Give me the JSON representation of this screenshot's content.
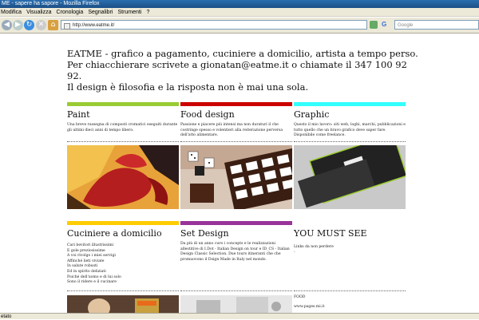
{
  "window": {
    "title": "ME - sapere ha sapore - Mozilla Firefox"
  },
  "menu": [
    "Modifica",
    "Visualizza",
    "Cronologia",
    "Segnalibri",
    "Strumenti",
    "?"
  ],
  "nav": {
    "url": "http://www.eatme.it/",
    "search_placeholder": "Google"
  },
  "intro": {
    "line1": "EATME - grafico a pagamento, cuciniere a domicilio, artista a tempo perso.",
    "line2": "Per chiacchierare scrivete a gionatan@eatme.it o chiamate il 347 100 92 92.",
    "line3": "Il design è filosofia e la risposta non è mai una sola."
  },
  "sections": {
    "paint": {
      "title": "Paint",
      "text": "Una breve rassegna di composti cromatici eseguiti durante gli ultimi dieci anni di tempo libero.",
      "color": "#99cc33"
    },
    "food": {
      "title": "Food design",
      "text": "Passione e piacere più intensi ma non duraturi il che costringe spesso e volentieri alla reiterazione perversa dell'atto alimentare.",
      "color": "#cc0000"
    },
    "graphic": {
      "title": "Graphic",
      "text": "Questo il mio lavoro: siti web, loghi, marchi, pubblicazioni e tutto quello che un bravo grafico deve saper fare. Disponibile come freelance.",
      "color": "#33ffff"
    },
    "cuciniere": {
      "title": "Cuciniere a domicilio",
      "lines": [
        "Cari bevitori illustrissimi",
        "E gole preziosissime",
        "A voi rivolgo i miei servigi",
        "Affinché lieti viviate",
        "In salute robusti",
        "Ed in spirito deliziati",
        "Poiché dell'uomo e di lui solo",
        "Sono il ridere e il cucinare"
      ],
      "color": "#ffcc00"
    },
    "setdesign": {
      "title": "Set Design",
      "text": "Da più di un anno curo i concepts e le realizzazioni allestitive di I.Dot - Italian Design on tour e ID_CS - Italian Design Classic Selection. Due tours itineranti che che promuovono il Dsign Made in Italy nel mondo.",
      "color": "#993399"
    },
    "youmustsee": {
      "title": "YOU MUST SEE",
      "text": "Links da non perdere",
      "sub": "-",
      "food_label": "FOOD",
      "link": "www.pages.mi.it"
    }
  },
  "status": {
    "text": "etato"
  }
}
